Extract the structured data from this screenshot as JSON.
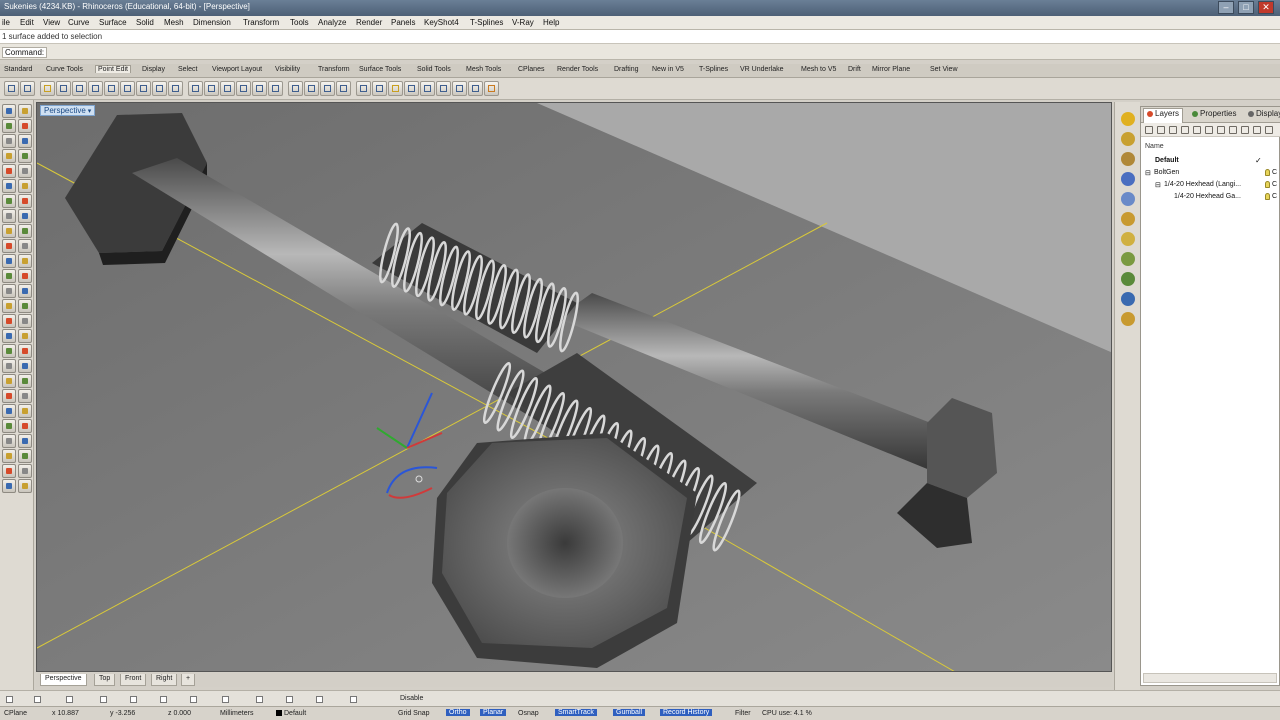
{
  "window": {
    "title": "Sukenies (4234.KB) - Rhinoceros (Educational, 64-bit) - [Perspective]",
    "buttons": [
      "–",
      "□",
      "✕"
    ]
  },
  "menu": [
    "ile",
    "Edit",
    "View",
    "Curve",
    "Surface",
    "Solid",
    "Mesh",
    "Dimension",
    "Transform",
    "Tools",
    "Analyze",
    "Render",
    "Panels",
    "KeyShot4",
    "T-Splines",
    "V-Ray",
    "Help"
  ],
  "history": {
    "text": "1 surface added to selection"
  },
  "command": {
    "label": "Command:"
  },
  "toolbar_tabs": [
    "Standard",
    "Curve Tools",
    "Point Edit",
    "Display",
    "Select",
    "Viewport Layout",
    "Visibility",
    "Transform",
    "Surface Tools",
    "Solid Tools",
    "Mesh Tools",
    "CPlanes",
    "Render Tools",
    "Drafting",
    "New in V5",
    "T-Splines",
    "VR Underlake",
    "Mesh to V5",
    "Drift",
    "Mirror Plane",
    "Set View"
  ],
  "toolbar_active_tab": "Point Edit",
  "viewport": {
    "label": "Perspective",
    "caret": "▾"
  },
  "panel": {
    "tabs": [
      {
        "label": "Layers",
        "color": "#d64a2a"
      },
      {
        "label": "Properties",
        "color": "#4a8a3a"
      },
      {
        "label": "Display",
        "color": "#666666"
      }
    ],
    "column_header": "Name",
    "layers": [
      {
        "name": "Default",
        "current": true,
        "check": "✓"
      },
      {
        "name": "BoltGen",
        "toggle": "⊟"
      },
      {
        "name": "1/4-20 Hexhead (Langi...",
        "toggle": "⊟"
      },
      {
        "name": "1/4-20 Hexhead Ga..."
      }
    ],
    "layer_color_stub": "C"
  },
  "viewport_tabs": [
    "Perspective",
    "Top",
    "Front",
    "Right",
    "+"
  ],
  "osnap": {
    "disable_label": "Disable"
  },
  "status": {
    "cplane": "CPlane",
    "x": "x 10.887",
    "y": "y -3.256",
    "z": "z 0.000",
    "units": "Millimeters",
    "layer": "Default",
    "panes": [
      "Grid Snap",
      "Ortho",
      "Planar",
      "Osnap",
      "SmartTrack",
      "Gumball",
      "Record History",
      "Filter"
    ],
    "message": "CPU use: 4.1 %"
  },
  "colors": {
    "viewport_bg": "#7f7f7f",
    "ground_plane": "#a9a9a9",
    "grid_axis": "#d9c93a",
    "status_highlight": "#2f5fbf"
  }
}
